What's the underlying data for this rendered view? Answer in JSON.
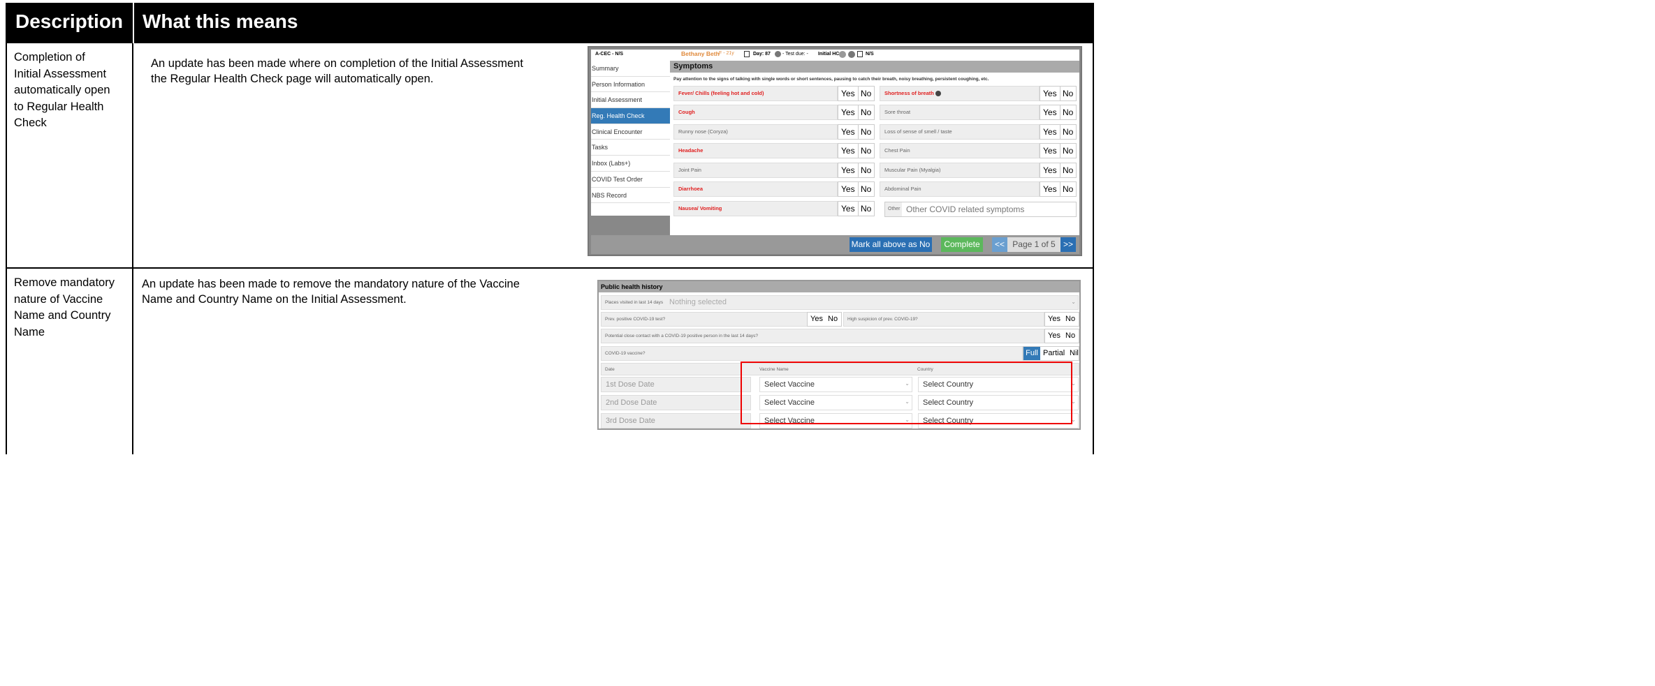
{
  "header": {
    "col1": "Description",
    "col2": "What this means"
  },
  "rows": [
    {
      "description_lines": [
        "Completion of",
        "Initial Assessment",
        "automatically open",
        "to Regular Health",
        "Check"
      ],
      "meaning_lines": [
        "An update has been made where on completion of the Initial Assessment",
        "the Regular Health Check page will automatically open."
      ]
    },
    {
      "description_lines": [
        "Remove mandatory",
        "nature of Vaccine",
        "Name and Country",
        "Name"
      ],
      "meaning_lines": [
        "An update has been made to remove the mandatory nature of the Vaccine",
        "Name and Country Name on the Initial Assessment."
      ]
    }
  ],
  "shot1": {
    "top_left": "A-CEC - N/S",
    "patient": "Bethany Beth",
    "patient_info": "F - 21y",
    "day": "Day: 87",
    "test_due": "- Test due: -",
    "initial_hcx": "Initial HCx",
    "ns": "N/S",
    "nav": [
      "Summary",
      "Person Information",
      "Initial Assessment",
      "Reg. Health Check",
      "Clinical Encounter",
      "Tasks",
      "Inbox (Labs+)",
      "COVID Test Order",
      "NBS Record"
    ],
    "section_title": "Symptoms",
    "note": "Pay attention to the signs of talking with single words or short sentences, pausing to catch their breath, noisy breathing, persistent coughing, etc.",
    "yes": "Yes",
    "no": "No",
    "left_symptoms": [
      "Fever/ Chills (feeling hot and cold)",
      "Cough",
      "Runny nose (Coryza)",
      "Headache",
      "Joint Pain",
      "Diarrhoea",
      "Nausea/ Vomiting"
    ],
    "right_symptoms": [
      "Shortness of breath",
      "Sore throat",
      "Loss of sense of smell / taste",
      "Chest Pain",
      "Muscular Pain (Myalgia)",
      "Abdominal Pain"
    ],
    "other_label": "Other",
    "other_placeholder": "Other COVID related symptoms",
    "mark_all": "Mark all above as No",
    "complete": "Complete",
    "prev": "<<",
    "page": "Page 1 of 5",
    "next": ">>",
    "colors": {
      "red": "#e02020",
      "blue": "#337ab7",
      "green": "#5cb85c",
      "patient": "#e08a3c"
    }
  },
  "shot2": {
    "title": "Public health history",
    "places_label": "Places visited in last 14 days",
    "places_value": "Nothing selected",
    "prev_test_label": "Prev. positive COVID-19 test?",
    "high_susp_label": "High suspicion of prev. COVID-19?",
    "contact_label": "Potential close contact with a COVID-19 positive person in the last 14 days?",
    "vaccine_label": "COVID-19 vaccine?",
    "vax_options": [
      "Full",
      "Partial",
      "Nil"
    ],
    "col_date": "Date",
    "col_vaccine": "Vaccine Name",
    "col_country": "Country",
    "doses": [
      "1st Dose Date",
      "2nd Dose Date",
      "3rd Dose Date"
    ],
    "select_vaccine": "Select Vaccine",
    "select_country": "Select Country",
    "yes": "Yes",
    "no": "No"
  }
}
